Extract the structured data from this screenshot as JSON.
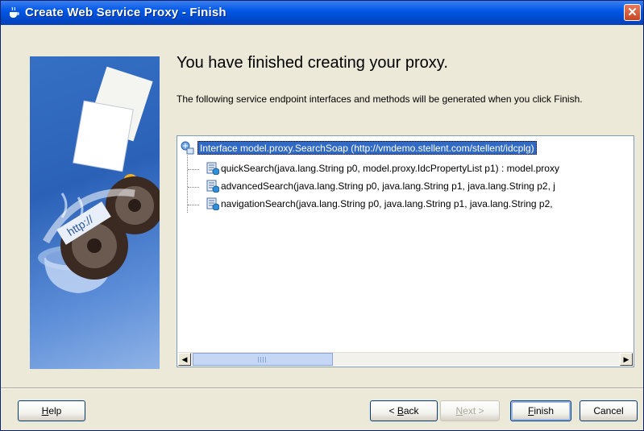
{
  "window": {
    "title": "Create Web Service Proxy - Finish",
    "close_glyph": "✕"
  },
  "content": {
    "heading": "You have finished creating your proxy.",
    "description": "The following service endpoint interfaces and methods will be generated when you click Finish."
  },
  "tree": {
    "root": "Interface model.proxy.SearchSoap (http://vmdemo.stellent.com/stellent/idcplg)",
    "items": [
      "quickSearch(java.lang.String p0, model.proxy.IdcPropertyList p1) : model.proxy",
      "advancedSearch(java.lang.String p0, java.lang.String p1, java.lang.String p2, j",
      "navigationSearch(java.lang.String p0, java.lang.String p1, java.lang.String p2,"
    ],
    "scroll_left_glyph": "◀",
    "scroll_right_glyph": "▶"
  },
  "buttons": {
    "help": {
      "mnemonic": "H",
      "rest": "elp"
    },
    "back": {
      "prefix": "< ",
      "mnemonic": "B",
      "rest": "ack"
    },
    "next": {
      "mnemonic": "N",
      "rest": "ext >"
    },
    "finish": {
      "mnemonic": "F",
      "rest": "inish"
    },
    "cancel": "Cancel"
  },
  "colors": {
    "titlebar": "#0054e3",
    "selection": "#316ac5",
    "dialog_bg": "#ece9d8"
  },
  "icons": [
    "coffee-cup-icon",
    "interface-node-icon",
    "method-node-icon",
    "close-icon"
  ]
}
